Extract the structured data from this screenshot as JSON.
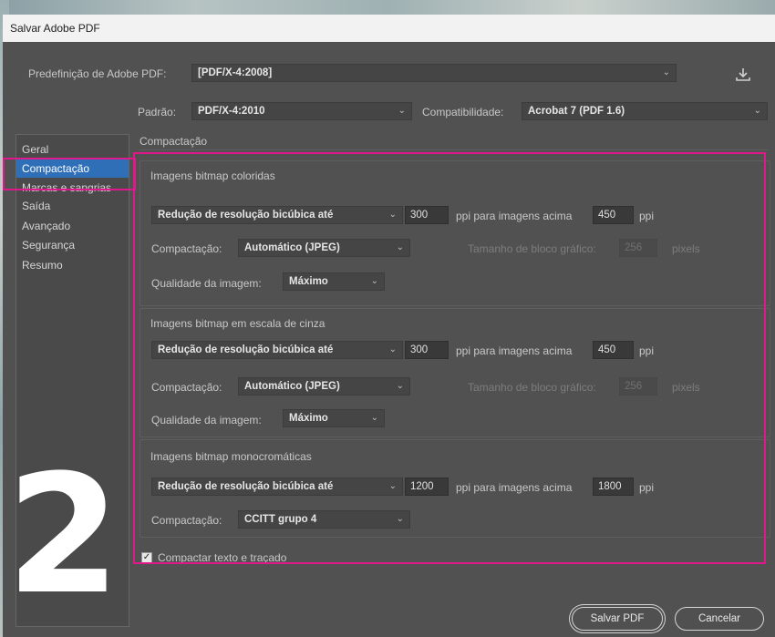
{
  "window": {
    "title": "Salvar Adobe PDF"
  },
  "preset": {
    "label": "Predefinição de Adobe PDF:",
    "value": "[PDF/X-4:2008]"
  },
  "standard": {
    "label": "Padrão:",
    "value": "PDF/X-4:2010"
  },
  "compatibility": {
    "label": "Compatibilidade:",
    "value": "Acrobat 7 (PDF 1.6)"
  },
  "sidebar": {
    "items": [
      {
        "label": "Geral"
      },
      {
        "label": "Compactação"
      },
      {
        "label": "Marcas e sangrias"
      },
      {
        "label": "Saída"
      },
      {
        "label": "Avançado"
      },
      {
        "label": "Segurança"
      },
      {
        "label": "Resumo"
      }
    ]
  },
  "section": {
    "title": "Compactação"
  },
  "color": {
    "title": "Imagens bitmap coloridas",
    "resample": "Redução de resolução bicúbica até",
    "ppi": "300",
    "above_label": "ppi para imagens acima",
    "above_ppi": "450",
    "ppi_unit": "ppi",
    "compression_label": "Compactação:",
    "compression": "Automático (JPEG)",
    "tile_label": "Tamanho de bloco gráfico:",
    "tile_value": "256",
    "tile_unit": "pixels",
    "quality_label": "Qualidade da imagem:",
    "quality": "Máximo"
  },
  "gray": {
    "title": "Imagens bitmap em escala de cinza",
    "resample": "Redução de resolução bicúbica até",
    "ppi": "300",
    "above_label": "ppi para imagens acima",
    "above_ppi": "450",
    "ppi_unit": "ppi",
    "compression_label": "Compactação:",
    "compression": "Automático (JPEG)",
    "tile_label": "Tamanho de bloco gráfico:",
    "tile_value": "256",
    "tile_unit": "pixels",
    "quality_label": "Qualidade da imagem:",
    "quality": "Máximo"
  },
  "mono": {
    "title": "Imagens bitmap monocromáticas",
    "resample": "Redução de resolução bicúbica até",
    "ppi": "1200",
    "above_label": "ppi para imagens acima",
    "above_ppi": "1800",
    "ppi_unit": "ppi",
    "compression_label": "Compactação:",
    "compression": "CCITT grupo 4"
  },
  "compress_text": {
    "label": "Compactar texto e traçado",
    "checked": true
  },
  "overlay_number": "2",
  "buttons": {
    "save": "Salvar PDF",
    "cancel": "Cancelar"
  },
  "colors": {
    "highlight": "#e0198a",
    "active": "#2f6fb8"
  },
  "icons": {
    "preset_save": "download-icon",
    "dropdown": "chevron-down-icon"
  }
}
